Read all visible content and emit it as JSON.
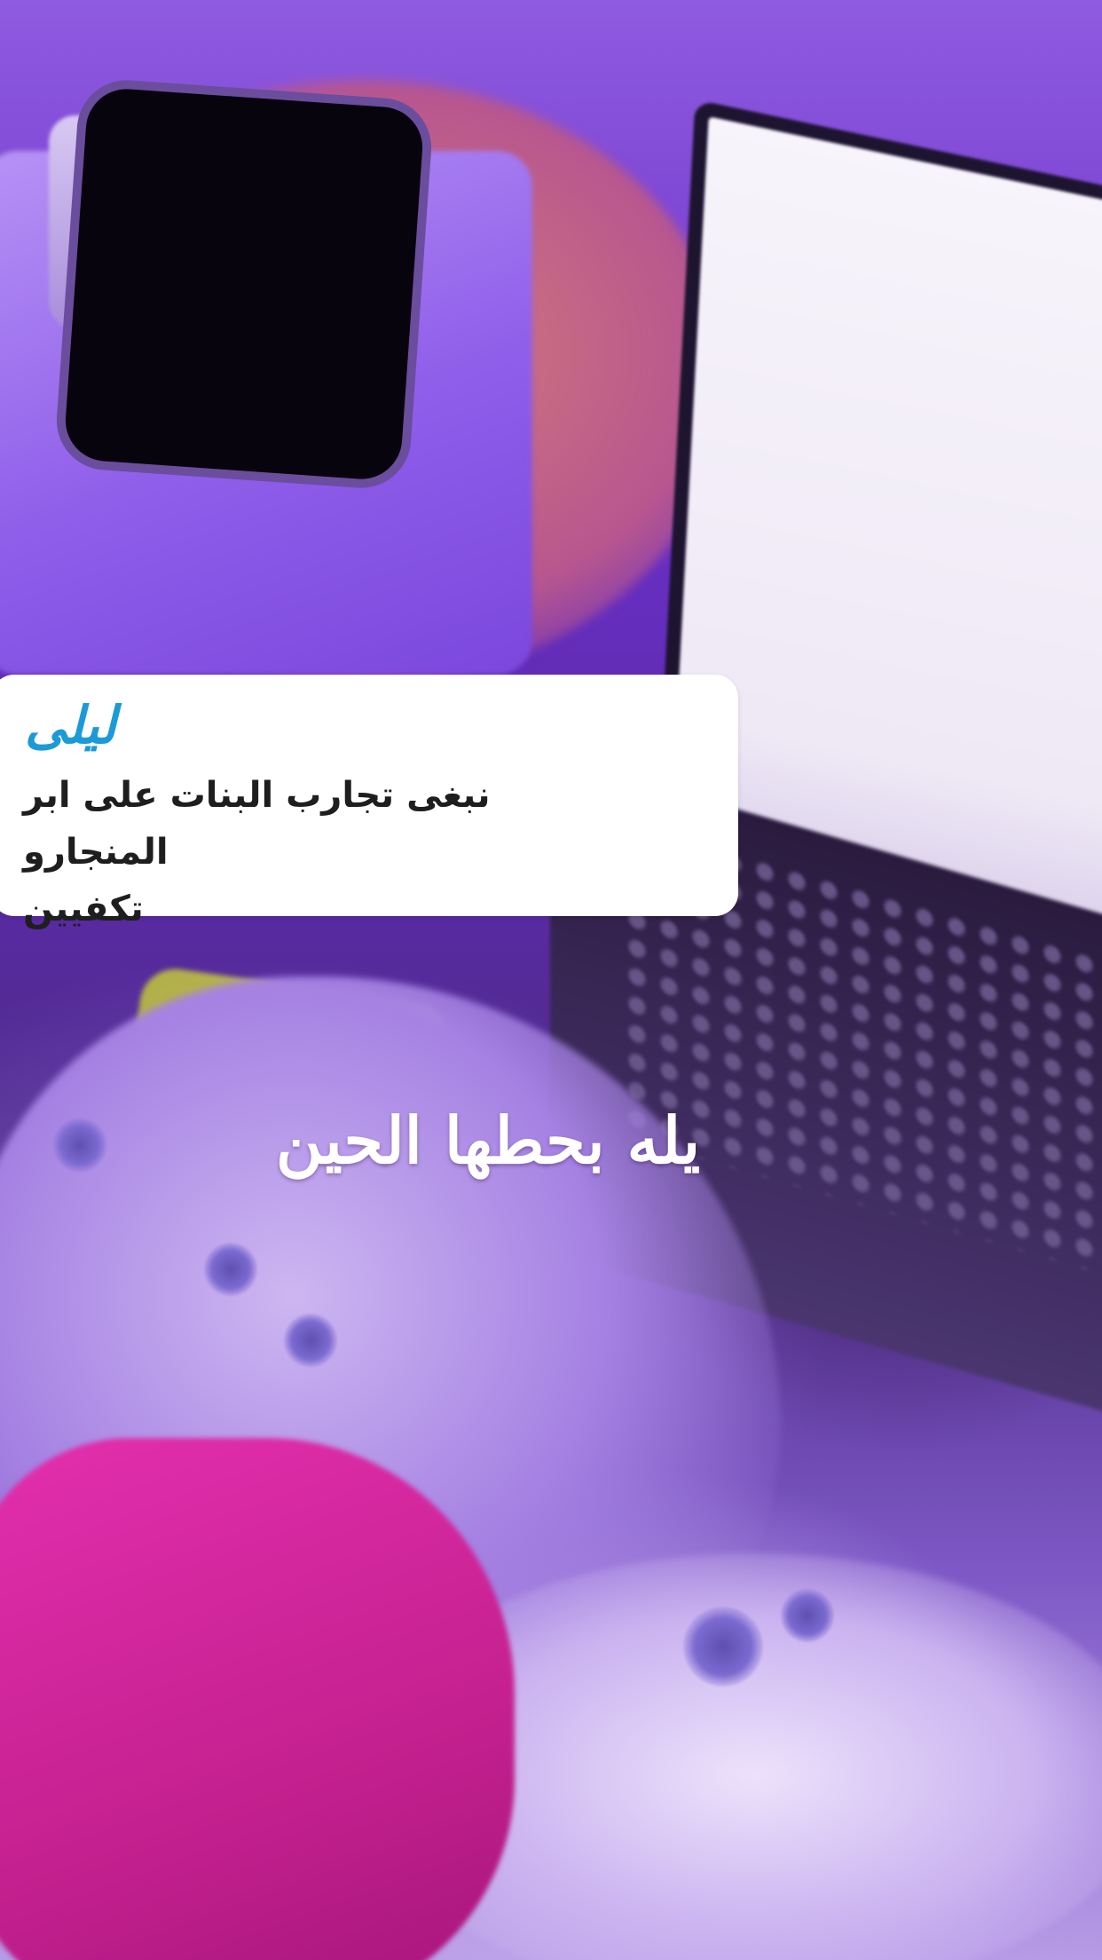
{
  "story": {
    "reply_card": {
      "name": "ليلى",
      "message_line1": "نبغى تجارب البنات على ابر المنجارو",
      "message_line2": "تكفيين",
      "name_color": "#1c9ad8",
      "background_color": "#ffffff"
    },
    "caption": "يله بحطها الحين",
    "theme_colors": {
      "ambient_purple": "#6a2fc7",
      "blanket_pink": "#c4208f"
    }
  }
}
